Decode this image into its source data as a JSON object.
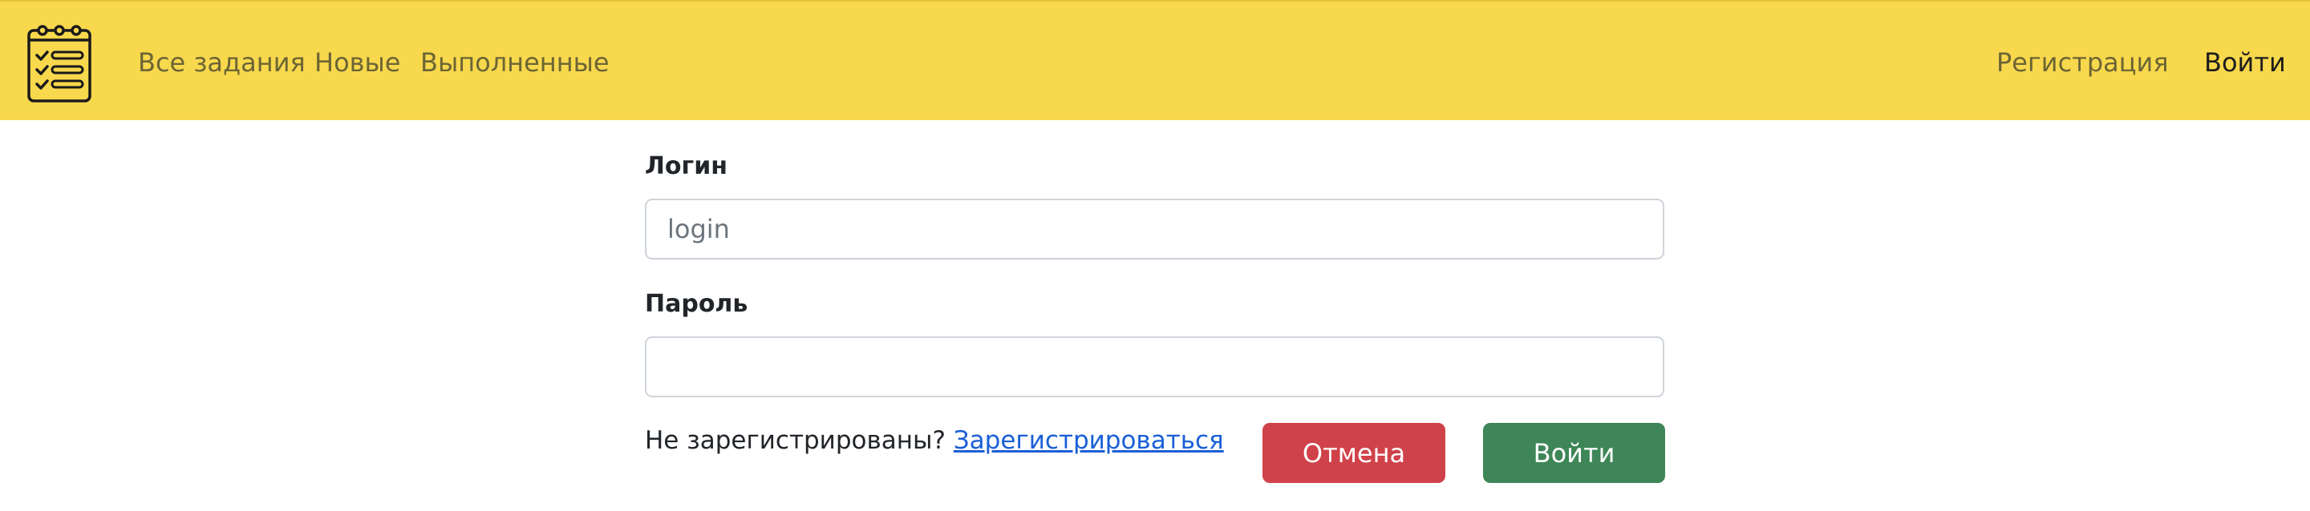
{
  "navbar": {
    "logo_icon": "clipboard-checklist-icon",
    "links": [
      {
        "label": "Все задания"
      },
      {
        "label": "Новые"
      },
      {
        "label": "Выполненные"
      }
    ],
    "register_label": "Регистрация",
    "login_label": "Войти"
  },
  "form": {
    "login": {
      "label": "Логин",
      "placeholder": "login",
      "value": ""
    },
    "password": {
      "label": "Пароль",
      "placeholder": "",
      "value": ""
    },
    "hint_text": "Не зарегистрированы? ",
    "register_link": "Зарегистрироваться",
    "cancel_label": "Отмена",
    "submit_label": "Войти"
  },
  "colors": {
    "navbar_bg": "#f8d84c",
    "cancel_bg": "#d0424a",
    "submit_bg": "#3e8658",
    "link": "#1a5fd6"
  }
}
